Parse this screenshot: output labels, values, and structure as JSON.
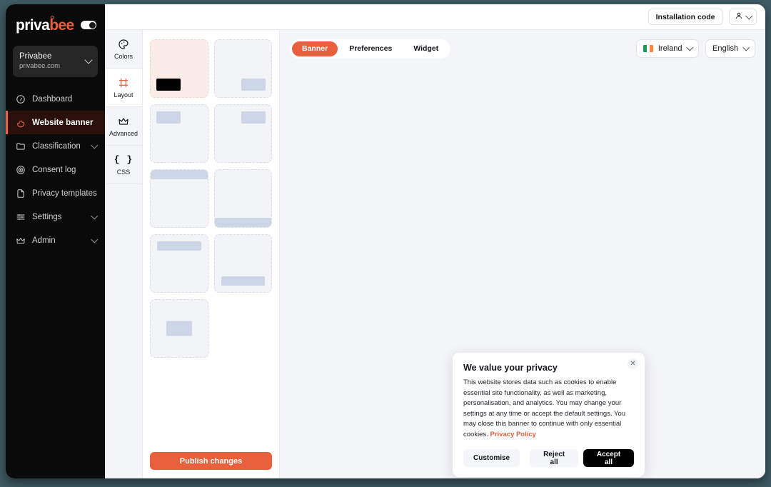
{
  "brand": {
    "name_part1": "priva",
    "name_part2": "bee",
    "toggle": "theme-toggle"
  },
  "workspace": {
    "name": "Privabee",
    "domain": "privabee.com"
  },
  "sidebar": {
    "items": [
      {
        "label": "Dashboard",
        "icon": "gauge-icon",
        "active": false,
        "expandable": false
      },
      {
        "label": "Website banner",
        "icon": "cookie-icon",
        "active": true,
        "expandable": false
      },
      {
        "label": "Classification",
        "icon": "folder-icon",
        "active": false,
        "expandable": true
      },
      {
        "label": "Consent log",
        "icon": "fingerprint-icon",
        "active": false,
        "expandable": false
      },
      {
        "label": "Privacy templates",
        "icon": "document-icon",
        "active": false,
        "expandable": false
      },
      {
        "label": "Settings",
        "icon": "sliders-icon",
        "active": false,
        "expandable": true
      },
      {
        "label": "Admin",
        "icon": "crown-icon",
        "active": false,
        "expandable": true
      }
    ]
  },
  "topbar": {
    "installation_code_label": "Installation code",
    "account_icon": "user-icon"
  },
  "editor_rail": {
    "items": [
      {
        "label": "Colors",
        "icon": "palette-icon",
        "active": false
      },
      {
        "label": "Layout",
        "icon": "frame-icon",
        "active": true
      },
      {
        "label": "Advanced",
        "icon": "crown-icon",
        "active": false
      },
      {
        "label": "CSS",
        "icon": "braces-icon",
        "active": false
      }
    ]
  },
  "layout_picker": {
    "tiles": [
      {
        "name": "bottom-left",
        "placement": "pl-bottom-left",
        "selected": true
      },
      {
        "name": "bottom-right",
        "placement": "pl-bottom-right",
        "selected": false
      },
      {
        "name": "top-left",
        "placement": "pl-top-left",
        "selected": false
      },
      {
        "name": "top-right",
        "placement": "pl-top-right",
        "selected": false
      },
      {
        "name": "top-bar",
        "placement": "pl-top-bar",
        "selected": false
      },
      {
        "name": "bottom-bar",
        "placement": "pl-bottom-bar",
        "selected": false
      },
      {
        "name": "top-pill",
        "placement": "pl-top-pill",
        "selected": false
      },
      {
        "name": "bottom-pill",
        "placement": "pl-bottom-pill",
        "selected": false
      },
      {
        "name": "center-modal",
        "placement": "pl-center",
        "selected": false
      }
    ],
    "publish_label": "Publish changes"
  },
  "preview_toolbar": {
    "tabs": [
      {
        "label": "Banner",
        "active": true
      },
      {
        "label": "Preferences",
        "active": false
      },
      {
        "label": "Widget",
        "active": false
      }
    ],
    "country": "Ireland",
    "country_flag": "ireland-flag-icon",
    "language": "English"
  },
  "cookie_banner": {
    "title": "We value your privacy",
    "body": "This website stores data such as cookies to enable essential site functionality, as well as marketing, personalisation, and analytics. You may change your settings at any time or accept the default settings. You may close this banner to continue with only essential cookies.",
    "policy_link": "Privacy Policy",
    "close_icon": "close-icon",
    "buttons": {
      "customise": "Customise",
      "reject": "Reject all",
      "accept": "Accept all"
    }
  },
  "colors": {
    "accent": "#e8603c",
    "sidebar_bg": "#0a0a0a",
    "active_nav_bg": "#2a100b",
    "selected_tile_bg": "#fcece7",
    "tile_bg": "#f2f4f8",
    "tile_block": "#ccd6e6",
    "page_bg": "#3e5a63",
    "panel_bg": "#f4f5f8"
  }
}
